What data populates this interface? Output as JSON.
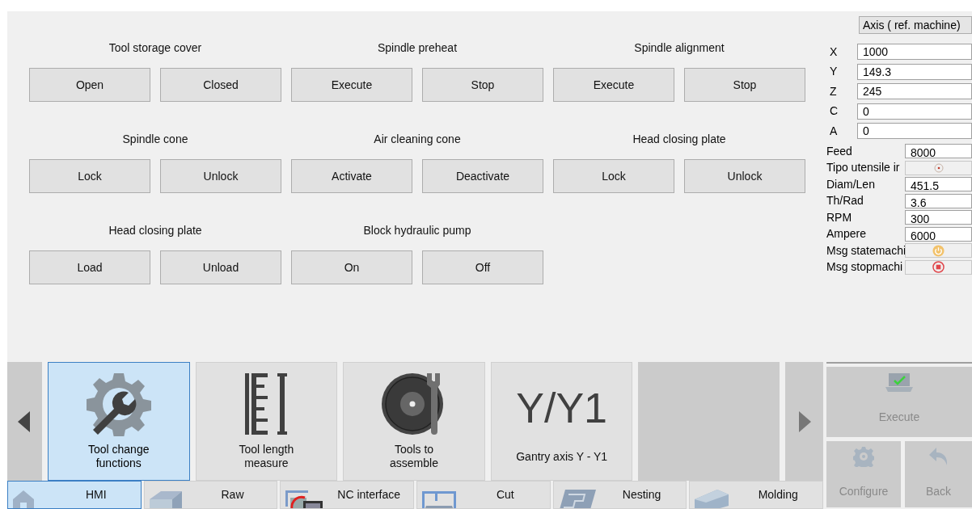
{
  "groups": [
    {
      "title": "Tool storage cover",
      "buttons": [
        "Open",
        "Closed"
      ]
    },
    {
      "title": "Spindle preheat",
      "buttons": [
        "Execute",
        "Stop"
      ]
    },
    {
      "title": "Spindle alignment",
      "buttons": [
        "Execute",
        "Stop"
      ]
    },
    {
      "title": "Spindle cone",
      "buttons": [
        "Lock",
        "Unlock"
      ]
    },
    {
      "title": "Air cleaning cone",
      "buttons": [
        "Activate",
        "Deactivate"
      ]
    },
    {
      "title": "Head closing plate",
      "buttons": [
        "Lock",
        "Unlock"
      ]
    },
    {
      "title": "Head closing plate",
      "buttons": [
        "Load",
        "Unload"
      ]
    },
    {
      "title": "Block hydraulic pump",
      "buttons": [
        "On",
        "Off"
      ]
    }
  ],
  "coordinate_dropdown": {
    "value": "Axis ( ref. machine)"
  },
  "axes": [
    {
      "label": "X",
      "value": "1000"
    },
    {
      "label": "Y",
      "value": "149.3"
    },
    {
      "label": "Z",
      "value": "245"
    },
    {
      "label": "C",
      "value": "0"
    },
    {
      "label": "A",
      "value": "0"
    }
  ],
  "params": [
    {
      "label": "Feed",
      "kind": "text",
      "value": "8000"
    },
    {
      "label": "Tipo utensile ir",
      "kind": "target"
    },
    {
      "label": "Diam/Len",
      "kind": "text",
      "value": "451.5"
    },
    {
      "label": "Th/Rad",
      "kind": "text",
      "value": "3.6"
    },
    {
      "label": "RPM",
      "kind": "text",
      "value": "300"
    },
    {
      "label": "Ampere",
      "kind": "text",
      "value": "6000"
    },
    {
      "label": "Msg statemachi",
      "kind": "power"
    },
    {
      "label": "Msg stopmachi",
      "kind": "stop"
    }
  ],
  "tiles": [
    {
      "label": "Tool change functions",
      "kind": "gear",
      "selected": true
    },
    {
      "label": "Tool length measure",
      "kind": "ruler",
      "selected": false
    },
    {
      "label": "Tools to assemble",
      "kind": "disc",
      "selected": false
    },
    {
      "label": "Gantry axis Y - Y1",
      "kind": "text",
      "caption": "Y/Y1",
      "selected": false
    },
    {
      "kind": "empty"
    }
  ],
  "tabs": [
    {
      "label": "HMI",
      "kind": "house",
      "selected": true
    },
    {
      "label": "Raw",
      "kind": "slab",
      "selected": false
    },
    {
      "label": "NC interface",
      "kind": "nc",
      "selected": false
    },
    {
      "label": "Cut",
      "kind": "cut",
      "selected": false
    },
    {
      "label": "Nesting",
      "kind": "nesting",
      "selected": false
    },
    {
      "label": "Molding",
      "kind": "molding",
      "selected": false
    }
  ],
  "actions": [
    {
      "label": "Execute",
      "kind": "execute",
      "disabled": true
    },
    {
      "label": "Configure",
      "kind": "configure",
      "disabled": true
    },
    {
      "label": "Back",
      "kind": "back",
      "disabled": true
    }
  ]
}
